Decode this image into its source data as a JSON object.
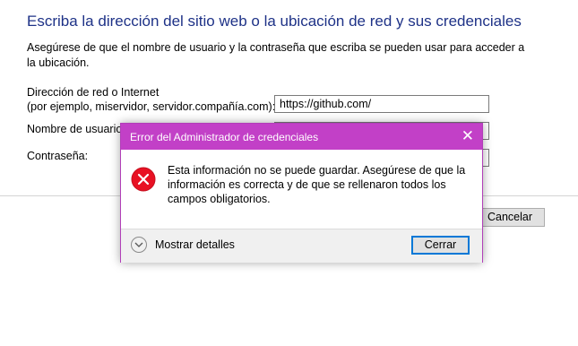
{
  "page": {
    "heading": "Escriba la dirección del sitio web o la ubicación de red y sus credenciales",
    "description": "Asegúrese de que el nombre de usuario y la contraseña que escriba se pueden usar para acceder a la ubicación."
  },
  "form": {
    "address_label_line1": "Dirección de red o Internet",
    "address_label_line2": "(por ejemplo, miservidor, servidor.compañía.com):",
    "address_value": "https://github.com/",
    "username_label": "Nombre de usuario:",
    "password_label": "Contraseña:",
    "cancel_label": "Cancelar"
  },
  "dialog": {
    "title": "Error del Administrador de credenciales",
    "close_glyph": "✕",
    "message": "Esta información no se puede guardar. Asegúrese de que la información es correcta y de que se rellenaron todos los campos obligatorios.",
    "details_label": "Mostrar detalles",
    "close_button_label": "Cerrar",
    "title_bar_color": "#c240c7",
    "error_color": "#e81123"
  },
  "icons": {
    "error": "error-icon",
    "chevron": "chevron-down-icon",
    "close": "close-icon"
  }
}
